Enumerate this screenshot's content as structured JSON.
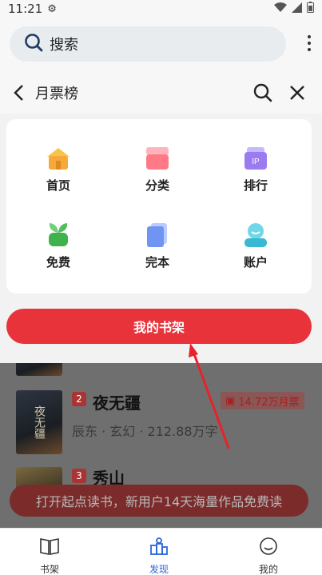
{
  "status_bar": {
    "time": "11:21"
  },
  "search": {
    "label": "搜索"
  },
  "header": {
    "title": "月票榜"
  },
  "grid": [
    {
      "label": "首页",
      "icon": "home-icon"
    },
    {
      "label": "分类",
      "icon": "category-icon"
    },
    {
      "label": "排行",
      "icon": "ranking-icon"
    },
    {
      "label": "免费",
      "icon": "free-icon"
    },
    {
      "label": "完本",
      "icon": "finished-icon"
    },
    {
      "label": "账户",
      "icon": "account-icon"
    }
  ],
  "grid_ranking_badge": "IP",
  "bookshelf_button": "我的书架",
  "books": [
    {
      "rank": "2",
      "title": "夜无疆",
      "meta": "辰东 · 玄幻 · 212.88万字",
      "ticket": "14.72万月票",
      "cover_text": "夜无疆"
    },
    {
      "rank": "3",
      "title": "秀山",
      "meta": "",
      "ticket": "",
      "cover_text": ""
    }
  ],
  "promo_banner": "打开起点读书，新用户14天海量作品免费读",
  "tabs": [
    {
      "label": "书架",
      "icon": "bookshelf-icon"
    },
    {
      "label": "发现",
      "icon": "discover-icon"
    },
    {
      "label": "我的",
      "icon": "profile-icon"
    }
  ],
  "colors": {
    "accent": "#e8333b",
    "active_tab": "#2b66d9",
    "arrow": "#e8222a"
  }
}
